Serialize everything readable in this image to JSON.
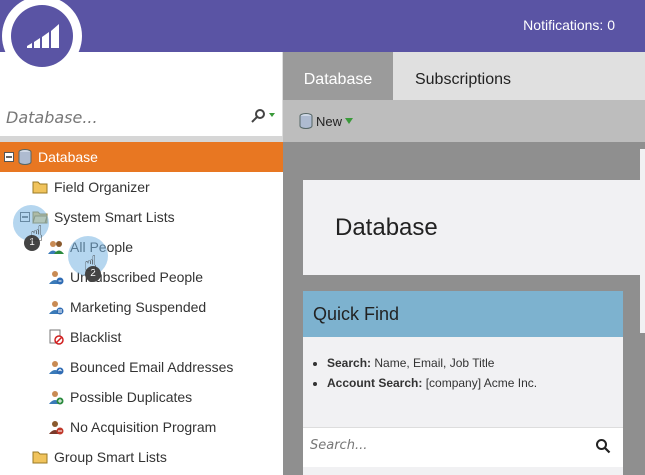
{
  "header": {
    "notifications_label": "Notifications: 0"
  },
  "sidebar": {
    "search_placeholder": "Database...",
    "tree": [
      {
        "label": "Database",
        "icon": "database-icon",
        "selected": true
      },
      {
        "label": "Field Organizer",
        "icon": "folder-icon"
      },
      {
        "label": "System Smart Lists",
        "icon": "folder-open-icon"
      },
      {
        "label": "All People",
        "icon": "people-icon"
      },
      {
        "label": "Unsubscribed People",
        "icon": "person-unsubscribe-icon"
      },
      {
        "label": "Marketing Suspended",
        "icon": "person-suspended-icon"
      },
      {
        "label": "Blacklist",
        "icon": "blacklist-icon"
      },
      {
        "label": "Bounced Email Addresses",
        "icon": "person-bounce-icon"
      },
      {
        "label": "Possible Duplicates",
        "icon": "person-duplicate-icon"
      },
      {
        "label": "No Acquisition Program",
        "icon": "person-no-program-icon"
      },
      {
        "label": "Group Smart Lists",
        "icon": "folder-icon"
      }
    ]
  },
  "tabs": [
    {
      "label": "Database",
      "active": true
    },
    {
      "label": "Subscriptions",
      "active": false
    }
  ],
  "toolbar": {
    "new_label": "New"
  },
  "main": {
    "title": "Database",
    "quick_find": {
      "title": "Quick Find",
      "items": [
        {
          "key": "Search:",
          "value": "Name, Email, Job Title"
        },
        {
          "key": "Account Search:",
          "value": "[company] Acme Inc."
        }
      ],
      "search_placeholder": "Search..."
    }
  },
  "callouts": [
    "1",
    "2"
  ],
  "colors": {
    "brand_purple": "#5a54a4",
    "selected_orange": "#e87722",
    "quick_find_blue": "#7db2cf"
  }
}
